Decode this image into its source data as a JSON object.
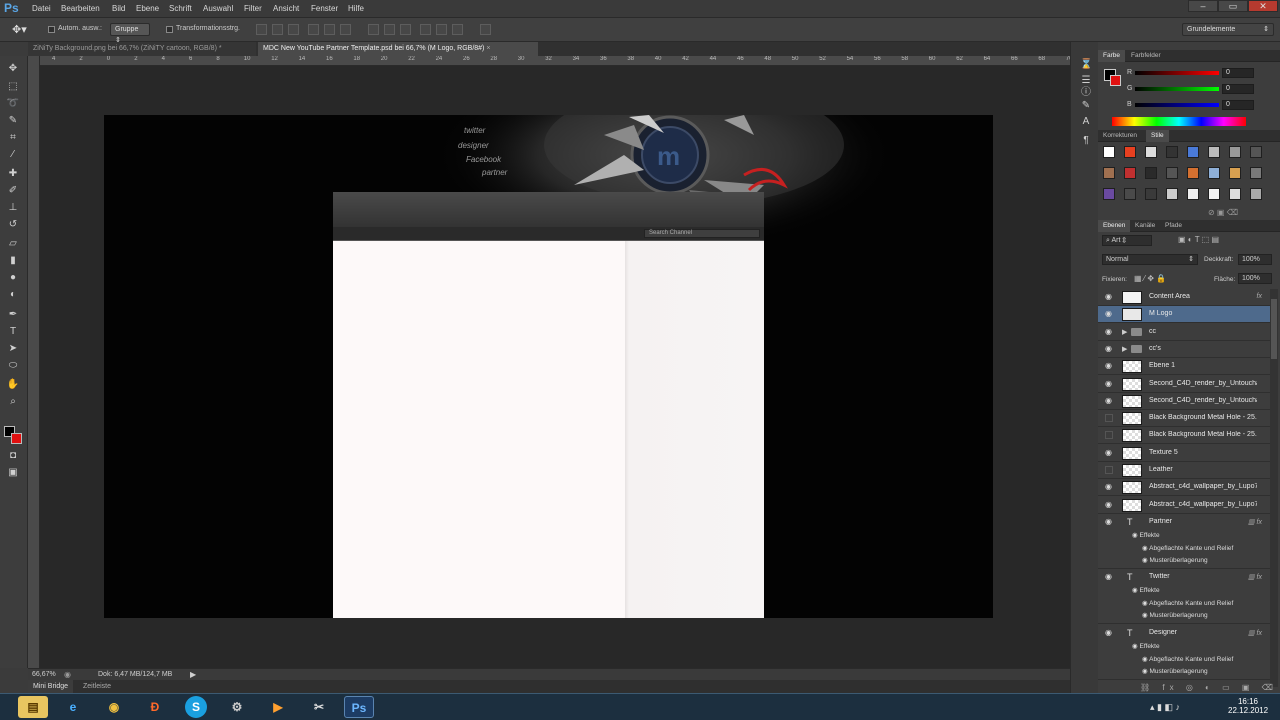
{
  "app": {
    "logo": "Ps",
    "accent": "#5aa6e6"
  },
  "menu": [
    "Datei",
    "Bearbeiten",
    "Bild",
    "Ebene",
    "Schrift",
    "Auswahl",
    "Filter",
    "Ansicht",
    "Fenster",
    "Hilfe"
  ],
  "options": {
    "auto_select_label": "Autom. ausw.:",
    "group_value": "Gruppe",
    "transform_label": "Transformationsstrg.",
    "workspace_value": "Grundelemente"
  },
  "tabs": [
    {
      "label": "ZiNiTy Background.png bei 66,7% (ZiNiTY cartoon, RGB/8) *",
      "active": false
    },
    {
      "label": "MDC New YouTube Partner Template.psd bei 66,7% (M Logo, RGB/8#)",
      "active": true
    }
  ],
  "ruler_marks": [
    "4",
    "2",
    "0",
    "2",
    "4",
    "6",
    "8",
    "10",
    "12",
    "14",
    "16",
    "18",
    "20",
    "22",
    "24",
    "26",
    "28",
    "30",
    "32",
    "34",
    "36",
    "38",
    "40",
    "42",
    "44",
    "46",
    "48",
    "50",
    "52",
    "54",
    "56",
    "58",
    "60",
    "62",
    "64",
    "66",
    "68",
    "70",
    "72"
  ],
  "canvas": {
    "banner_words": [
      "twitter",
      "designer",
      "Facebook",
      "partner"
    ],
    "search_placeholder": "Search Channel"
  },
  "status": {
    "zoom": "66,67%",
    "doc_info": "Dok: 6,47 MB/124,7 MB"
  },
  "bottom_tabs": [
    "Mini Bridge",
    "Zeitleiste"
  ],
  "color_panel": {
    "tabs": [
      "Farbe",
      "Farbfelder"
    ],
    "channels": [
      {
        "label": "R",
        "value": "0"
      },
      {
        "label": "G",
        "value": "0"
      },
      {
        "label": "B",
        "value": "0"
      }
    ]
  },
  "styles_panel": {
    "tabs": [
      "Korrekturen",
      "Stile"
    ]
  },
  "layers_panel": {
    "tabs": [
      "Ebenen",
      "Kanäle",
      "Pfade"
    ],
    "filter_label": "Art",
    "blend_mode": "Normal",
    "opacity_label": "Deckkraft:",
    "opacity_value": "100%",
    "lock_label": "Fixieren:",
    "fill_label": "Fläche:",
    "fill_value": "100%",
    "layers": [
      {
        "name": "Content Area",
        "visible": true,
        "fx": true,
        "kind": "white"
      },
      {
        "name": "M Logo",
        "visible": true,
        "fx": false,
        "kind": "smart",
        "selected": true
      },
      {
        "name": "cc",
        "visible": true,
        "fx": false,
        "kind": "folder"
      },
      {
        "name": "cc's",
        "visible": true,
        "fx": false,
        "kind": "folder"
      },
      {
        "name": "Ebene 1",
        "visible": true,
        "fx": false,
        "kind": "check"
      },
      {
        "name": "Second_C4D_render_by_Untoucha...",
        "visible": true,
        "fx": false,
        "kind": "check"
      },
      {
        "name": "Second_C4D_render_by_Untoucha...",
        "visible": true,
        "fx": false,
        "kind": "check"
      },
      {
        "name": "Black Background Metal Hole - 25...",
        "visible": false,
        "fx": false,
        "kind": "check"
      },
      {
        "name": "Black Background Metal Hole - 25...",
        "visible": false,
        "fx": false,
        "kind": "check"
      },
      {
        "name": "Texture 5",
        "visible": true,
        "fx": false,
        "kind": "check"
      },
      {
        "name": "Leather",
        "visible": false,
        "fx": false,
        "kind": "check"
      },
      {
        "name": "Abstract_c4d_wallpaper_by_Lupo7...",
        "visible": true,
        "fx": false,
        "kind": "check"
      },
      {
        "name": "Abstract_c4d_wallpaper_by_Lupo7",
        "visible": true,
        "fx": false,
        "kind": "check"
      }
    ],
    "text_layers": [
      {
        "name": "Partner",
        "effects": "Effekte",
        "e1": "Abgeflachte Kante und Relief",
        "e2": "Musterüberlagerung"
      },
      {
        "name": "Twitter",
        "effects": "Effekte",
        "e1": "Abgeflachte Kante und Relief",
        "e2": "Musterüberlagerung"
      },
      {
        "name": "Designer",
        "effects": "Effekte",
        "e1": "Abgeflachte Kante und Relief",
        "e2": "Musterüberlagerung"
      }
    ]
  },
  "taskbar": {
    "time": "16:16",
    "date": "22.12.2012"
  }
}
